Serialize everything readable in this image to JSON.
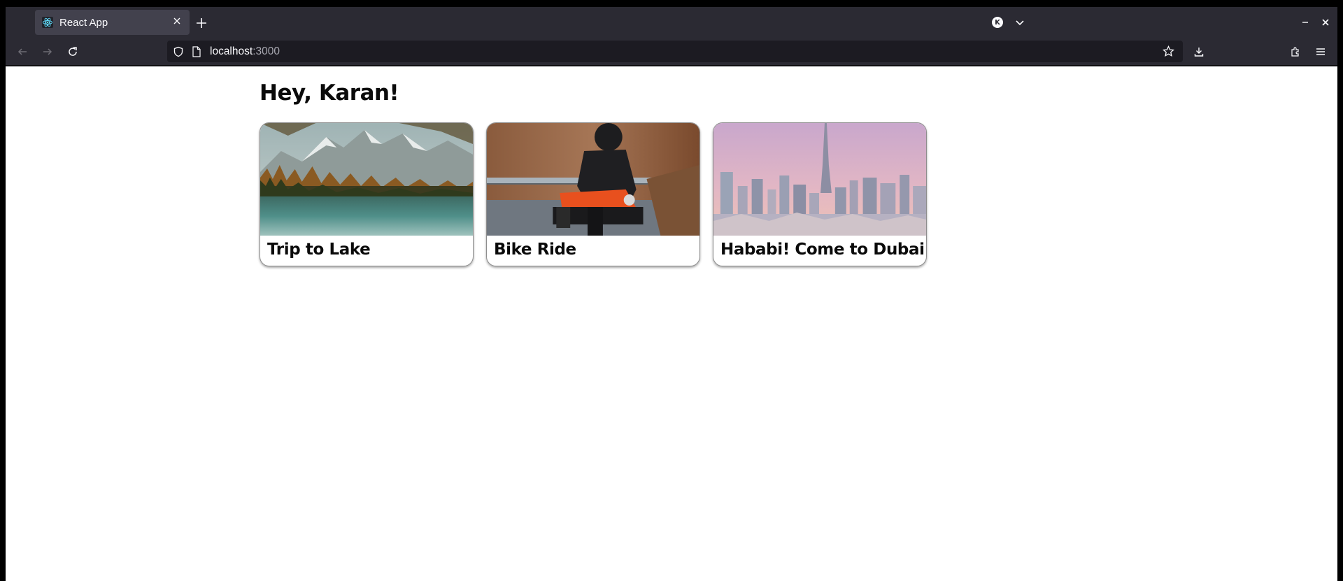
{
  "browser": {
    "tab_title": "React App",
    "url_host": "localhost",
    "url_port": ":3000",
    "profile_initial": "K"
  },
  "page": {
    "greeting": "Hey, Karan!",
    "cards": [
      {
        "title": "Trip to Lake",
        "image": "mountain lake with pine forest"
      },
      {
        "title": "Bike Ride",
        "image": "motorcyclist on orange motorbike"
      },
      {
        "title": "Hababi! Come to Dubai",
        "image": "Dubai skyline at dusk"
      }
    ]
  },
  "colors": {
    "toolbar": "#2b2a33",
    "urlbar": "#1c1b22",
    "active_tab": "#42414d",
    "page_bg": "#ffffff"
  }
}
